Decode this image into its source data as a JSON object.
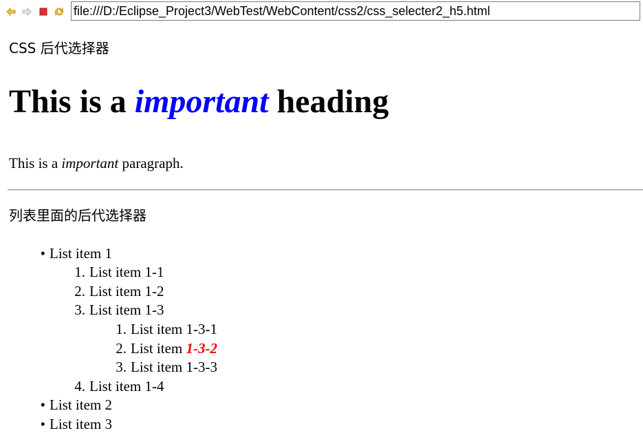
{
  "browser": {
    "url": "file:///D:/Eclipse_Project3/WebTest/WebContent/css2/css_selecter2_h5.html",
    "icons": [
      "back-arrow-icon",
      "forward-arrow-icon",
      "stop-icon",
      "refresh-icon"
    ]
  },
  "page": {
    "section1_title": "CSS 后代选择器",
    "heading": {
      "before": "This is a ",
      "emphasis": "important",
      "after": " heading",
      "emphasis_color": "#0000ff"
    },
    "paragraph": {
      "before": "This is a ",
      "emphasis": "important",
      "after": " paragraph."
    },
    "section2_title": "列表里面的后代选择器",
    "list": {
      "item1": "List item 1",
      "item1_1": "List item 1-1",
      "item1_2": "List item 1-2",
      "item1_3": "List item 1-3",
      "item1_3_1": "List item 1-3-1",
      "item1_3_2_prefix": "List item ",
      "item1_3_2_emphasis": "1-3-2",
      "item1_3_3": "List item 1-3-3",
      "item1_4": "List item 1-4",
      "item2": "List item 2",
      "item3": "List item 3",
      "highlight_color": "#ff0000"
    },
    "markers": {
      "bullet": "•",
      "n1": "1.",
      "n2": "2.",
      "n3": "3.",
      "n4": "4."
    }
  }
}
